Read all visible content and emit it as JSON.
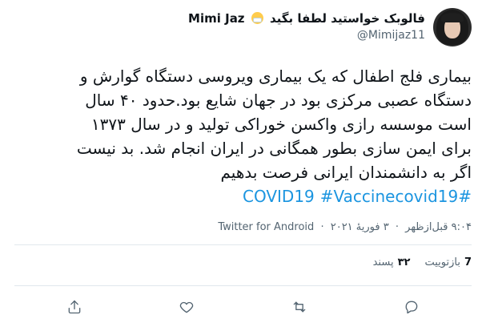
{
  "author": {
    "display_name": "Mimi Jaz",
    "name_suffix": "فالوبک خواستید لطفا بگید",
    "handle": "@Mimijaz11"
  },
  "tweet": {
    "lines": [
      "بیماری فلج اطفال که یک بیماری ویروسی دستگاه گوارش و",
      "دستگاه عصبی مرکزی بود در جهان شایع بود.حدود ۴۰ سال",
      "است موسسه رازی واکسن خوراکی تولید و در سال ۱۳۷۳",
      "برای ایمن سازی بطور همگانی در ایران انجام شد. بد نیست",
      "اگر به دانشمندان ایرانی فرصت بدهیم"
    ],
    "hashtags": [
      "#COVID19",
      "#Vaccinecovid19"
    ]
  },
  "meta": {
    "time": "۹:۰۴ قبل‌ازظهر",
    "date": "۳ فوریهٔ ۲۰۲۱",
    "separator": "·",
    "source": "Twitter for Android"
  },
  "stats": {
    "retweets_count": "7",
    "retweets_label": "بازتوییت",
    "likes_count": "۳۲",
    "likes_label": "پسند"
  },
  "icons": {
    "reply": "reply-icon",
    "retweet": "retweet-icon",
    "like": "heart-icon",
    "share": "share-icon"
  }
}
